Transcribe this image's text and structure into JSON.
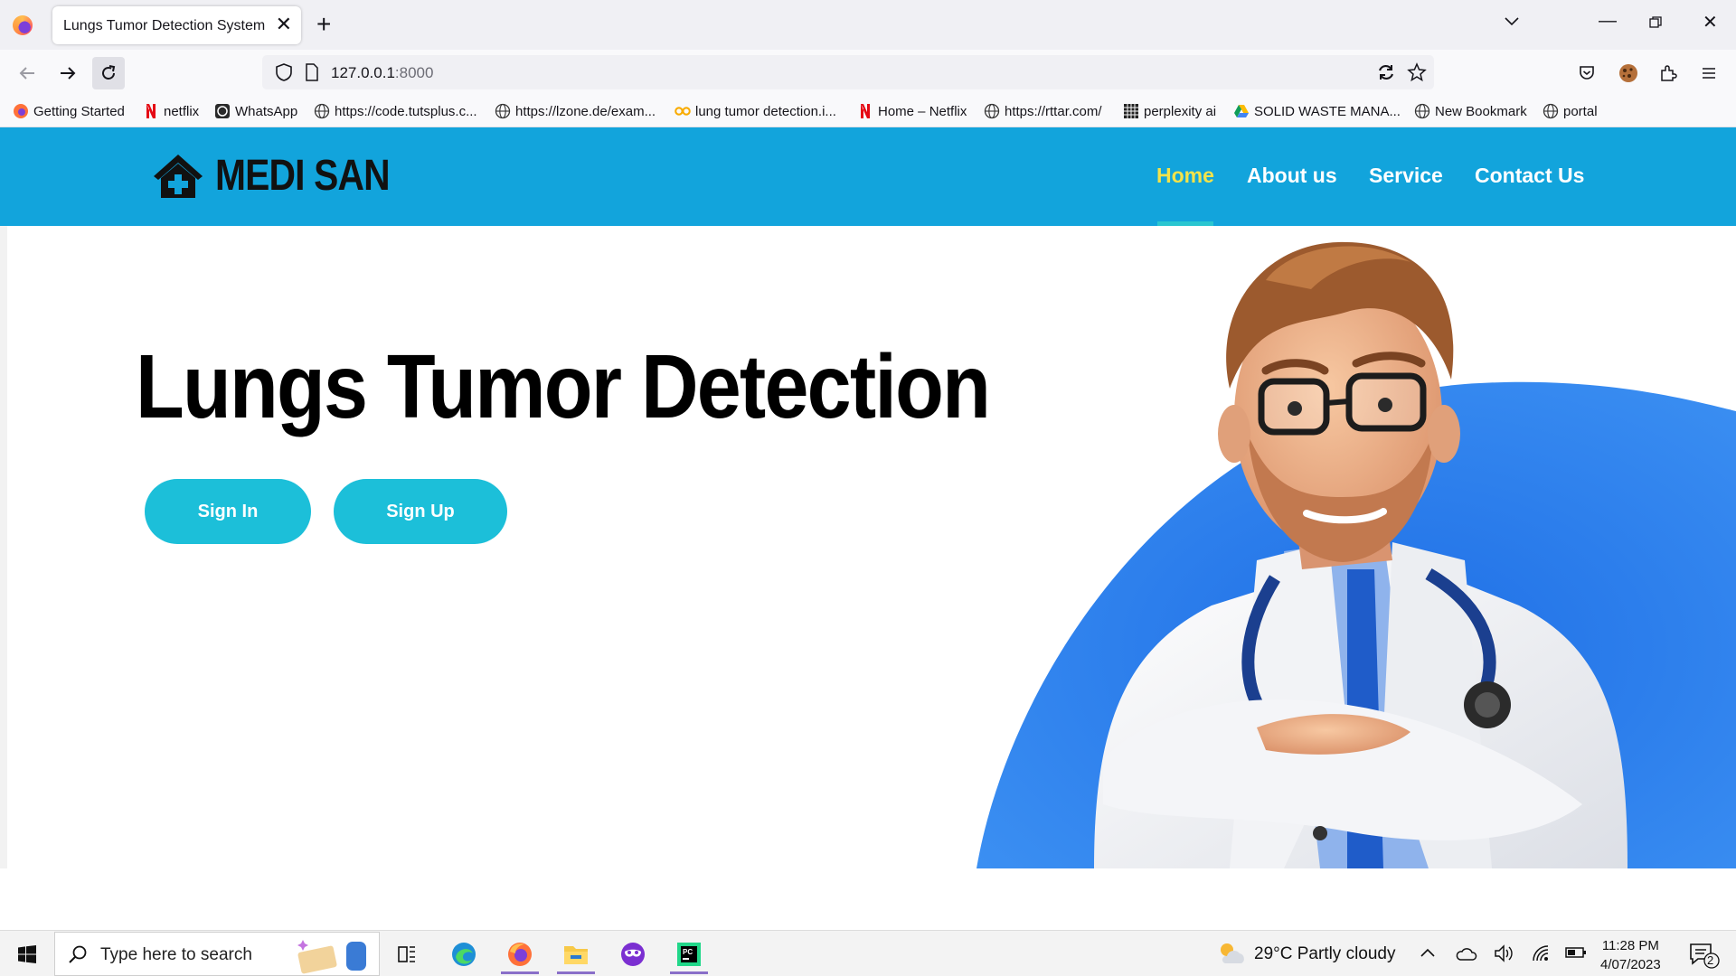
{
  "browser": {
    "tab_title": "Lungs Tumor Detection System",
    "url_host": "127.0.0.1",
    "url_port": ":8000",
    "bookmarks": [
      {
        "label": "Getting Started",
        "icon": "firefox-icon"
      },
      {
        "label": "netflix",
        "icon": "netflix-icon"
      },
      {
        "label": "WhatsApp",
        "icon": "whatsapp-icon"
      },
      {
        "label": "https://code.tutsplus.c...",
        "icon": "globe-icon"
      },
      {
        "label": "https://lzone.de/exam...",
        "icon": "globe-icon"
      },
      {
        "label": "lung tumor detection.i...",
        "icon": "colab-icon"
      },
      {
        "label": "Home – Netflix",
        "icon": "netflix-icon"
      },
      {
        "label": "https://rttar.com/",
        "icon": "globe-icon"
      },
      {
        "label": "perplexity ai",
        "icon": "perplexity-icon"
      },
      {
        "label": "SOLID WASTE MANA...",
        "icon": "drive-icon"
      },
      {
        "label": "New Bookmark",
        "icon": "globe-icon"
      },
      {
        "label": "portal",
        "icon": "globe-icon"
      }
    ]
  },
  "site": {
    "brand": "MEDI SAN",
    "nav": [
      {
        "label": "Home",
        "active": true
      },
      {
        "label": "About us",
        "active": false
      },
      {
        "label": "Service",
        "active": false
      },
      {
        "label": "Contact Us",
        "active": false
      }
    ],
    "hero_title": "Lungs Tumor Detection",
    "sign_in": "Sign In",
    "sign_up": "Sign Up",
    "colors": {
      "header": "#12a4dc",
      "active_nav": "#f3e34a",
      "button": "#1cbfd9",
      "art_blue": "#2f86ef"
    }
  },
  "taskbar": {
    "search_placeholder": "Type here to search",
    "weather": "29°C  Partly cloudy",
    "time": "11:28 PM",
    "date": "4/07/2023",
    "notifications": "2"
  }
}
